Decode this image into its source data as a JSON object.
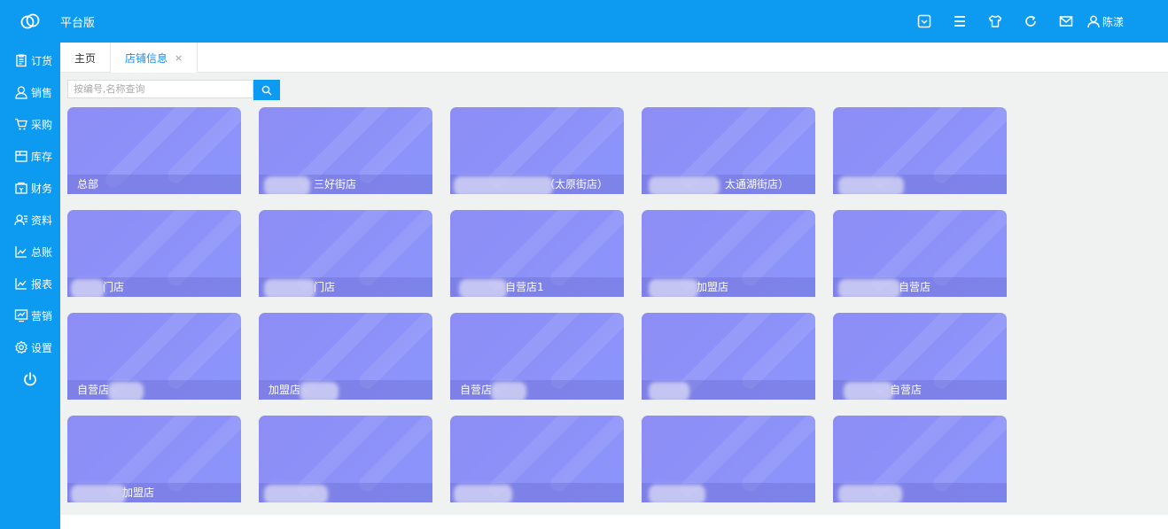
{
  "app": {
    "title": "平台版"
  },
  "header": {
    "user_name": "陈漾"
  },
  "sidebar": {
    "items": [
      {
        "label": "订货",
        "icon": "clipboard-icon"
      },
      {
        "label": "销售",
        "icon": "person-icon"
      },
      {
        "label": "采购",
        "icon": "cart-icon"
      },
      {
        "label": "库存",
        "icon": "storage-box-icon"
      },
      {
        "label": "财务",
        "icon": "safe-icon"
      },
      {
        "label": "资料",
        "icon": "contacts-icon"
      },
      {
        "label": "总账",
        "icon": "line-chart-icon"
      },
      {
        "label": "报表",
        "icon": "line-chart-icon"
      },
      {
        "label": "营销",
        "icon": "monitor-chart-icon"
      },
      {
        "label": "设置",
        "icon": "gear-icon"
      }
    ]
  },
  "tabs": {
    "home": "主页",
    "store_info": "店铺信息",
    "close": "×"
  },
  "search": {
    "placeholder": "按编号,名称查询"
  },
  "stores": [
    {
      "name": "总部"
    },
    {
      "name": "三好街店"
    },
    {
      "name": "（太原街店）"
    },
    {
      "name": "太通湖街店）"
    },
    {
      "name": ""
    },
    {
      "name": "门店"
    },
    {
      "name": "门店"
    },
    {
      "name": "自营店1"
    },
    {
      "name": "加盟店"
    },
    {
      "name": "自营店"
    },
    {
      "name": "自营店"
    },
    {
      "name": "加盟店"
    },
    {
      "name": "自营店"
    },
    {
      "name": ""
    },
    {
      "name": "自营店"
    },
    {
      "name": "加盟店"
    },
    {
      "name": ""
    },
    {
      "name": ""
    },
    {
      "name": ""
    },
    {
      "name": ""
    }
  ],
  "colors": {
    "primary": "#0d9bf2",
    "card": "#8d8df5",
    "content_bg": "#f0f2f2"
  }
}
